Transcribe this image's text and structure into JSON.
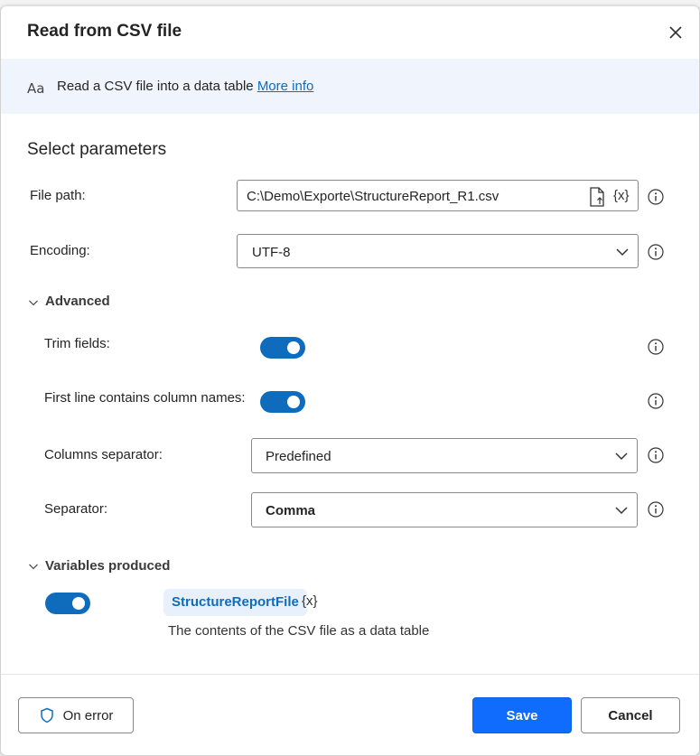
{
  "dialog": {
    "title": "Read from CSV file",
    "close_icon": "close-icon"
  },
  "banner": {
    "icon": "text-aa-icon",
    "icon_text": "Aa",
    "description": "Read a CSV file into a data table",
    "link": "More info"
  },
  "parameters": {
    "heading": "Select parameters",
    "file_path": {
      "label": "File path:",
      "value": "C:\\Demo\\Exporte\\StructureReport_R1.csv",
      "variable_button": "{x}"
    },
    "encoding": {
      "label": "Encoding:",
      "value": "UTF-8"
    }
  },
  "advanced": {
    "header": "Advanced",
    "trim_fields": {
      "label": "Trim fields:",
      "on": true
    },
    "first_line": {
      "label": "First line contains column names:",
      "on": true
    },
    "columns_separator": {
      "label": "Columns separator:",
      "value": "Predefined"
    },
    "separator": {
      "label": "Separator:",
      "value": "Comma"
    }
  },
  "variables": {
    "header": "Variables produced",
    "enabled": true,
    "name": "StructureReportFile",
    "variable_button": "{x}",
    "description": "The contents of the CSV file as a data table"
  },
  "footer": {
    "on_error": "On error",
    "save": "Save",
    "cancel": "Cancel"
  },
  "colors": {
    "accent": "#0f6cbd",
    "primary_button": "#0f6cfd",
    "banner_bg": "#f0f5fd"
  }
}
